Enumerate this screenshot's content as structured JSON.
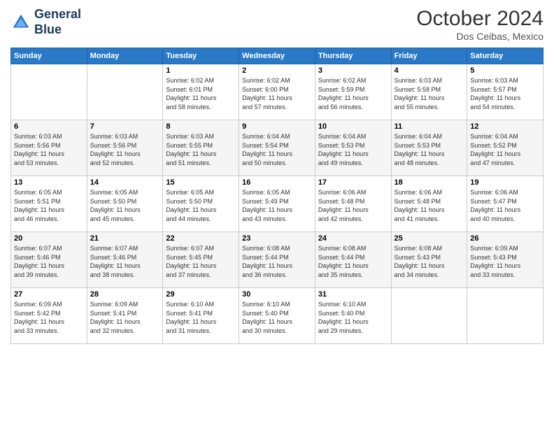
{
  "header": {
    "logo_line1": "General",
    "logo_line2": "Blue",
    "month": "October 2024",
    "location": "Dos Ceibas, Mexico"
  },
  "weekdays": [
    "Sunday",
    "Monday",
    "Tuesday",
    "Wednesday",
    "Thursday",
    "Friday",
    "Saturday"
  ],
  "weeks": [
    [
      {
        "day": "",
        "content": ""
      },
      {
        "day": "",
        "content": ""
      },
      {
        "day": "1",
        "content": "Sunrise: 6:02 AM\nSunset: 6:01 PM\nDaylight: 11 hours\nand 58 minutes."
      },
      {
        "day": "2",
        "content": "Sunrise: 6:02 AM\nSunset: 6:00 PM\nDaylight: 11 hours\nand 57 minutes."
      },
      {
        "day": "3",
        "content": "Sunrise: 6:02 AM\nSunset: 5:59 PM\nDaylight: 11 hours\nand 56 minutes."
      },
      {
        "day": "4",
        "content": "Sunrise: 6:03 AM\nSunset: 5:58 PM\nDaylight: 11 hours\nand 55 minutes."
      },
      {
        "day": "5",
        "content": "Sunrise: 6:03 AM\nSunset: 5:57 PM\nDaylight: 11 hours\nand 54 minutes."
      }
    ],
    [
      {
        "day": "6",
        "content": "Sunrise: 6:03 AM\nSunset: 5:56 PM\nDaylight: 11 hours\nand 53 minutes."
      },
      {
        "day": "7",
        "content": "Sunrise: 6:03 AM\nSunset: 5:56 PM\nDaylight: 11 hours\nand 52 minutes."
      },
      {
        "day": "8",
        "content": "Sunrise: 6:03 AM\nSunset: 5:55 PM\nDaylight: 11 hours\nand 51 minutes."
      },
      {
        "day": "9",
        "content": "Sunrise: 6:04 AM\nSunset: 5:54 PM\nDaylight: 11 hours\nand 50 minutes."
      },
      {
        "day": "10",
        "content": "Sunrise: 6:04 AM\nSunset: 5:53 PM\nDaylight: 11 hours\nand 49 minutes."
      },
      {
        "day": "11",
        "content": "Sunrise: 6:04 AM\nSunset: 5:53 PM\nDaylight: 11 hours\nand 48 minutes."
      },
      {
        "day": "12",
        "content": "Sunrise: 6:04 AM\nSunset: 5:52 PM\nDaylight: 11 hours\nand 47 minutes."
      }
    ],
    [
      {
        "day": "13",
        "content": "Sunrise: 6:05 AM\nSunset: 5:51 PM\nDaylight: 11 hours\nand 46 minutes."
      },
      {
        "day": "14",
        "content": "Sunrise: 6:05 AM\nSunset: 5:50 PM\nDaylight: 11 hours\nand 45 minutes."
      },
      {
        "day": "15",
        "content": "Sunrise: 6:05 AM\nSunset: 5:50 PM\nDaylight: 11 hours\nand 44 minutes."
      },
      {
        "day": "16",
        "content": "Sunrise: 6:05 AM\nSunset: 5:49 PM\nDaylight: 11 hours\nand 43 minutes."
      },
      {
        "day": "17",
        "content": "Sunrise: 6:06 AM\nSunset: 5:48 PM\nDaylight: 11 hours\nand 42 minutes."
      },
      {
        "day": "18",
        "content": "Sunrise: 6:06 AM\nSunset: 5:48 PM\nDaylight: 11 hours\nand 41 minutes."
      },
      {
        "day": "19",
        "content": "Sunrise: 6:06 AM\nSunset: 5:47 PM\nDaylight: 11 hours\nand 40 minutes."
      }
    ],
    [
      {
        "day": "20",
        "content": "Sunrise: 6:07 AM\nSunset: 5:46 PM\nDaylight: 11 hours\nand 39 minutes."
      },
      {
        "day": "21",
        "content": "Sunrise: 6:07 AM\nSunset: 5:46 PM\nDaylight: 11 hours\nand 38 minutes."
      },
      {
        "day": "22",
        "content": "Sunrise: 6:07 AM\nSunset: 5:45 PM\nDaylight: 11 hours\nand 37 minutes."
      },
      {
        "day": "23",
        "content": "Sunrise: 6:08 AM\nSunset: 5:44 PM\nDaylight: 11 hours\nand 36 minutes."
      },
      {
        "day": "24",
        "content": "Sunrise: 6:08 AM\nSunset: 5:44 PM\nDaylight: 11 hours\nand 35 minutes."
      },
      {
        "day": "25",
        "content": "Sunrise: 6:08 AM\nSunset: 5:43 PM\nDaylight: 11 hours\nand 34 minutes."
      },
      {
        "day": "26",
        "content": "Sunrise: 6:09 AM\nSunset: 5:43 PM\nDaylight: 11 hours\nand 33 minutes."
      }
    ],
    [
      {
        "day": "27",
        "content": "Sunrise: 6:09 AM\nSunset: 5:42 PM\nDaylight: 11 hours\nand 33 minutes."
      },
      {
        "day": "28",
        "content": "Sunrise: 6:09 AM\nSunset: 5:41 PM\nDaylight: 11 hours\nand 32 minutes."
      },
      {
        "day": "29",
        "content": "Sunrise: 6:10 AM\nSunset: 5:41 PM\nDaylight: 11 hours\nand 31 minutes."
      },
      {
        "day": "30",
        "content": "Sunrise: 6:10 AM\nSunset: 5:40 PM\nDaylight: 11 hours\nand 30 minutes."
      },
      {
        "day": "31",
        "content": "Sunrise: 6:10 AM\nSunset: 5:40 PM\nDaylight: 11 hours\nand 29 minutes."
      },
      {
        "day": "",
        "content": ""
      },
      {
        "day": "",
        "content": ""
      }
    ]
  ]
}
